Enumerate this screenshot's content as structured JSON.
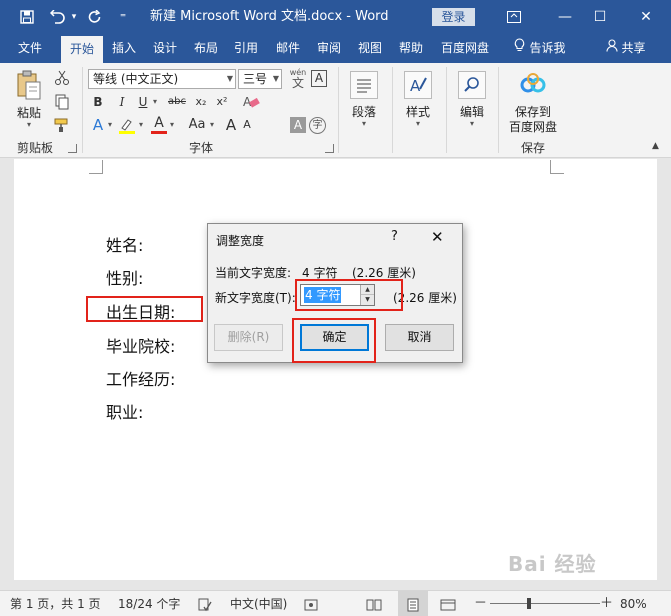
{
  "window": {
    "title": "新建 Microsoft Word 文档.docx  -  Word",
    "login_label": "登录",
    "controls": {
      "minimize": "—",
      "restore": "☐",
      "close": "✕"
    }
  },
  "quick_access": {
    "save": "💾",
    "undo": "↶",
    "undo_caret": "▾",
    "redo": "↻",
    "customize": "⁼"
  },
  "ribbon_tabs": [
    {
      "label": "文件"
    },
    {
      "label": "开始"
    },
    {
      "label": "插入"
    },
    {
      "label": "设计"
    },
    {
      "label": "布局"
    },
    {
      "label": "引用"
    },
    {
      "label": "邮件"
    },
    {
      "label": "审阅"
    },
    {
      "label": "视图"
    },
    {
      "label": "帮助"
    },
    {
      "label": "百度网盘"
    }
  ],
  "tell_me": {
    "icon": "lightbulb-icon",
    "label": "告诉我"
  },
  "share": {
    "icon": "person-icon",
    "label": "共享"
  },
  "clipboard": {
    "paste_label": "粘贴",
    "group_label": "剪贴板"
  },
  "font": {
    "font_name": "等线 (中文正文)",
    "font_size": "三号",
    "wen": "wén",
    "wen_char": "文",
    "a_box": "A",
    "bold": "B",
    "italic": "I",
    "underline": "U",
    "strike": "abc",
    "sub": "x₂",
    "sup": "x²",
    "clear_glyph": "A",
    "effects": "A",
    "highlight": "ab",
    "font_color": "A",
    "case": "Aa",
    "grow": "A",
    "shrink": "A",
    "char_shading": "A",
    "enclose": "字",
    "group_label": "字体"
  },
  "paragraph": {
    "label": "段落"
  },
  "styles": {
    "label": "样式"
  },
  "editing": {
    "label": "编辑"
  },
  "save_baidu": {
    "label_line1": "保存到",
    "label_line2": "百度网盘",
    "group_label": "保存"
  },
  "document": {
    "lines": [
      "姓名:",
      "性别:",
      "出生日期:",
      "毕业院校:",
      "工作经历:",
      "职业:"
    ]
  },
  "dialog": {
    "title": "调整宽度",
    "help": "?",
    "close": "✕",
    "current_label": "当前文字宽度:",
    "current_value": "4 字符",
    "current_cm": "(2.26 厘米)",
    "new_label": "新文字宽度(T):",
    "new_value": "4 字符",
    "new_cm": "(2.26 厘米)",
    "delete_button": "删除(R)",
    "ok_button": "确定",
    "cancel_button": "取消"
  },
  "status": {
    "page": "第 1 页，共 1 页",
    "words": "18/24 个字",
    "language": "中文(中国)",
    "zoom_minus": "－",
    "zoom_plus": "＋",
    "zoom_level": "80%",
    "zoom_fraction": 0.8
  },
  "watermark": "Bai 经验",
  "colors": {
    "brand": "#2b579a",
    "highlight_red": "#e2231a",
    "selection": "#3399ff"
  }
}
